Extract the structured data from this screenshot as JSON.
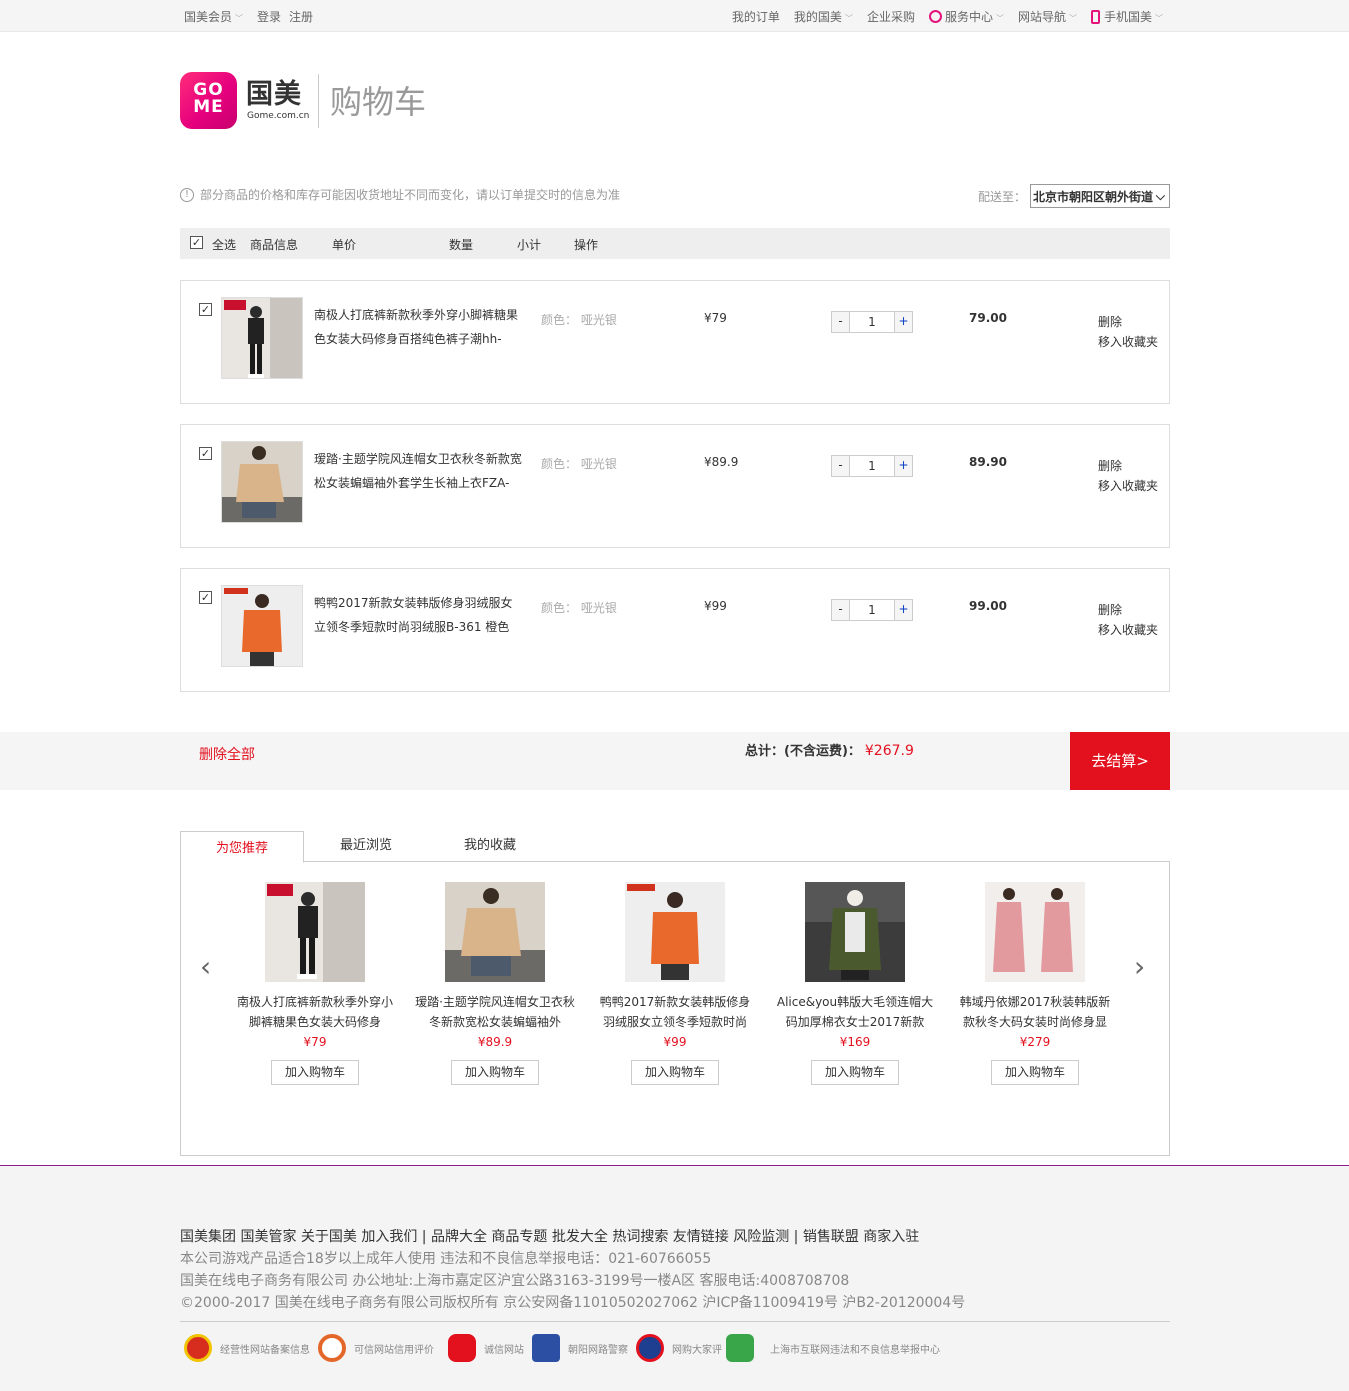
{
  "topbar": {
    "member": "国美会员",
    "login": "登录",
    "register": "注册",
    "my_orders": "我的订单",
    "my_gome": "我的国美",
    "enterprise": "企业采购",
    "service": "服务中心",
    "site_nav": "网站导航",
    "mobile": "手机国美"
  },
  "header": {
    "logo_text": "GOME",
    "logo_cn": "国美",
    "logo_sub": "Gome.com.cn",
    "title": "购物车"
  },
  "notice": "部分商品的价格和库存可能因收货地址不同而变化，请以订单提交时的信息为准",
  "shipping": {
    "label": "配送至：",
    "address": "北京市朝阳区朝外街道"
  },
  "table_header": {
    "select_all": "全选",
    "product": "商品信息",
    "unit_price": "单价",
    "quantity": "数量",
    "subtotal": "小计",
    "actions": "操作"
  },
  "cart_items": [
    {
      "name": "南极人打底裤新款秋季外穿小脚裤糖果色女装大码修身百搭纯色裤子潮hh-",
      "attr": "颜色： 哑光银",
      "price": "¥79",
      "qty": "1",
      "subtotal": "79.00",
      "delete": "删除",
      "favorite": "移入收藏夹",
      "checked": true
    },
    {
      "name": "瑷踏·主题学院风连帽女卫衣秋冬新款宽松女装蝙蝠袖外套学生长袖上衣FZA-",
      "attr": "颜色： 哑光银",
      "price": "¥89.9",
      "qty": "1",
      "subtotal": "89.90",
      "delete": "删除",
      "favorite": "移入收藏夹",
      "checked": true
    },
    {
      "name": "鸭鸭2017新款女装韩版修身羽绒服女立领冬季短款时尚羽绒服B-361 橙色",
      "attr": "颜色： 哑光银",
      "price": "¥99",
      "qty": "1",
      "subtotal": "99.00",
      "delete": "删除",
      "favorite": "移入收藏夹",
      "checked": true
    }
  ],
  "summary": {
    "delete_all": "删除全部",
    "total_label": "总计：(不含运费)：",
    "total_amount": "¥267.9",
    "checkout": "去结算>"
  },
  "rec_tabs": [
    "为您推荐",
    "最近浏览",
    "我的收藏"
  ],
  "recommendations": [
    {
      "name": "南极人打底裤新款秋季外穿小脚裤糖果色女装大码修身",
      "price": "¥79",
      "button": "加入购物车"
    },
    {
      "name": "瑷踏·主题学院风连帽女卫衣秋冬新款宽松女装蝙蝠袖外",
      "price": "¥89.9",
      "button": "加入购物车"
    },
    {
      "name": "鸭鸭2017新款女装韩版修身羽绒服女立领冬季短款时尚",
      "price": "¥99",
      "button": "加入购物车"
    },
    {
      "name": "Alice&you韩版大毛领连帽大码加厚棉衣女士2017新款",
      "price": "¥169",
      "button": "加入购物车"
    },
    {
      "name": "韩域丹依娜2017秋装韩版新款秋冬大码女装时尚修身显",
      "price": "¥279",
      "button": "加入购物车"
    }
  ],
  "footer": {
    "links": "国美集团  国美管家  关于国美  加入我们 | 品牌大全  商品专题  批发大全  热词搜索  友情链接  风险监测 | 销售联盟  商家入驻",
    "line1": "本公司游戏产品适合18岁以上成年人使用 违法和不良信息举报电话：021-60766055",
    "line2": "国美在线电子商务有限公司 办公地址:上海市嘉定区沪宜公路3163-3199号一楼A区 客服电话:4008708708",
    "line3": "©2000-2017 国美在线电子商务有限公司版权所有 京公安网备11010502027062 沪ICP备11009419号 沪B2-20120004号",
    "badges": [
      "经营性网站备案信息",
      "可信网站信用评价",
      "诚信网站",
      "朝阳网路警察",
      "网购大家评",
      "上海市互联网违法和不良信息举报中心"
    ]
  },
  "colors": {
    "brand": "#e6007e",
    "accent_red": "#e3101e"
  }
}
